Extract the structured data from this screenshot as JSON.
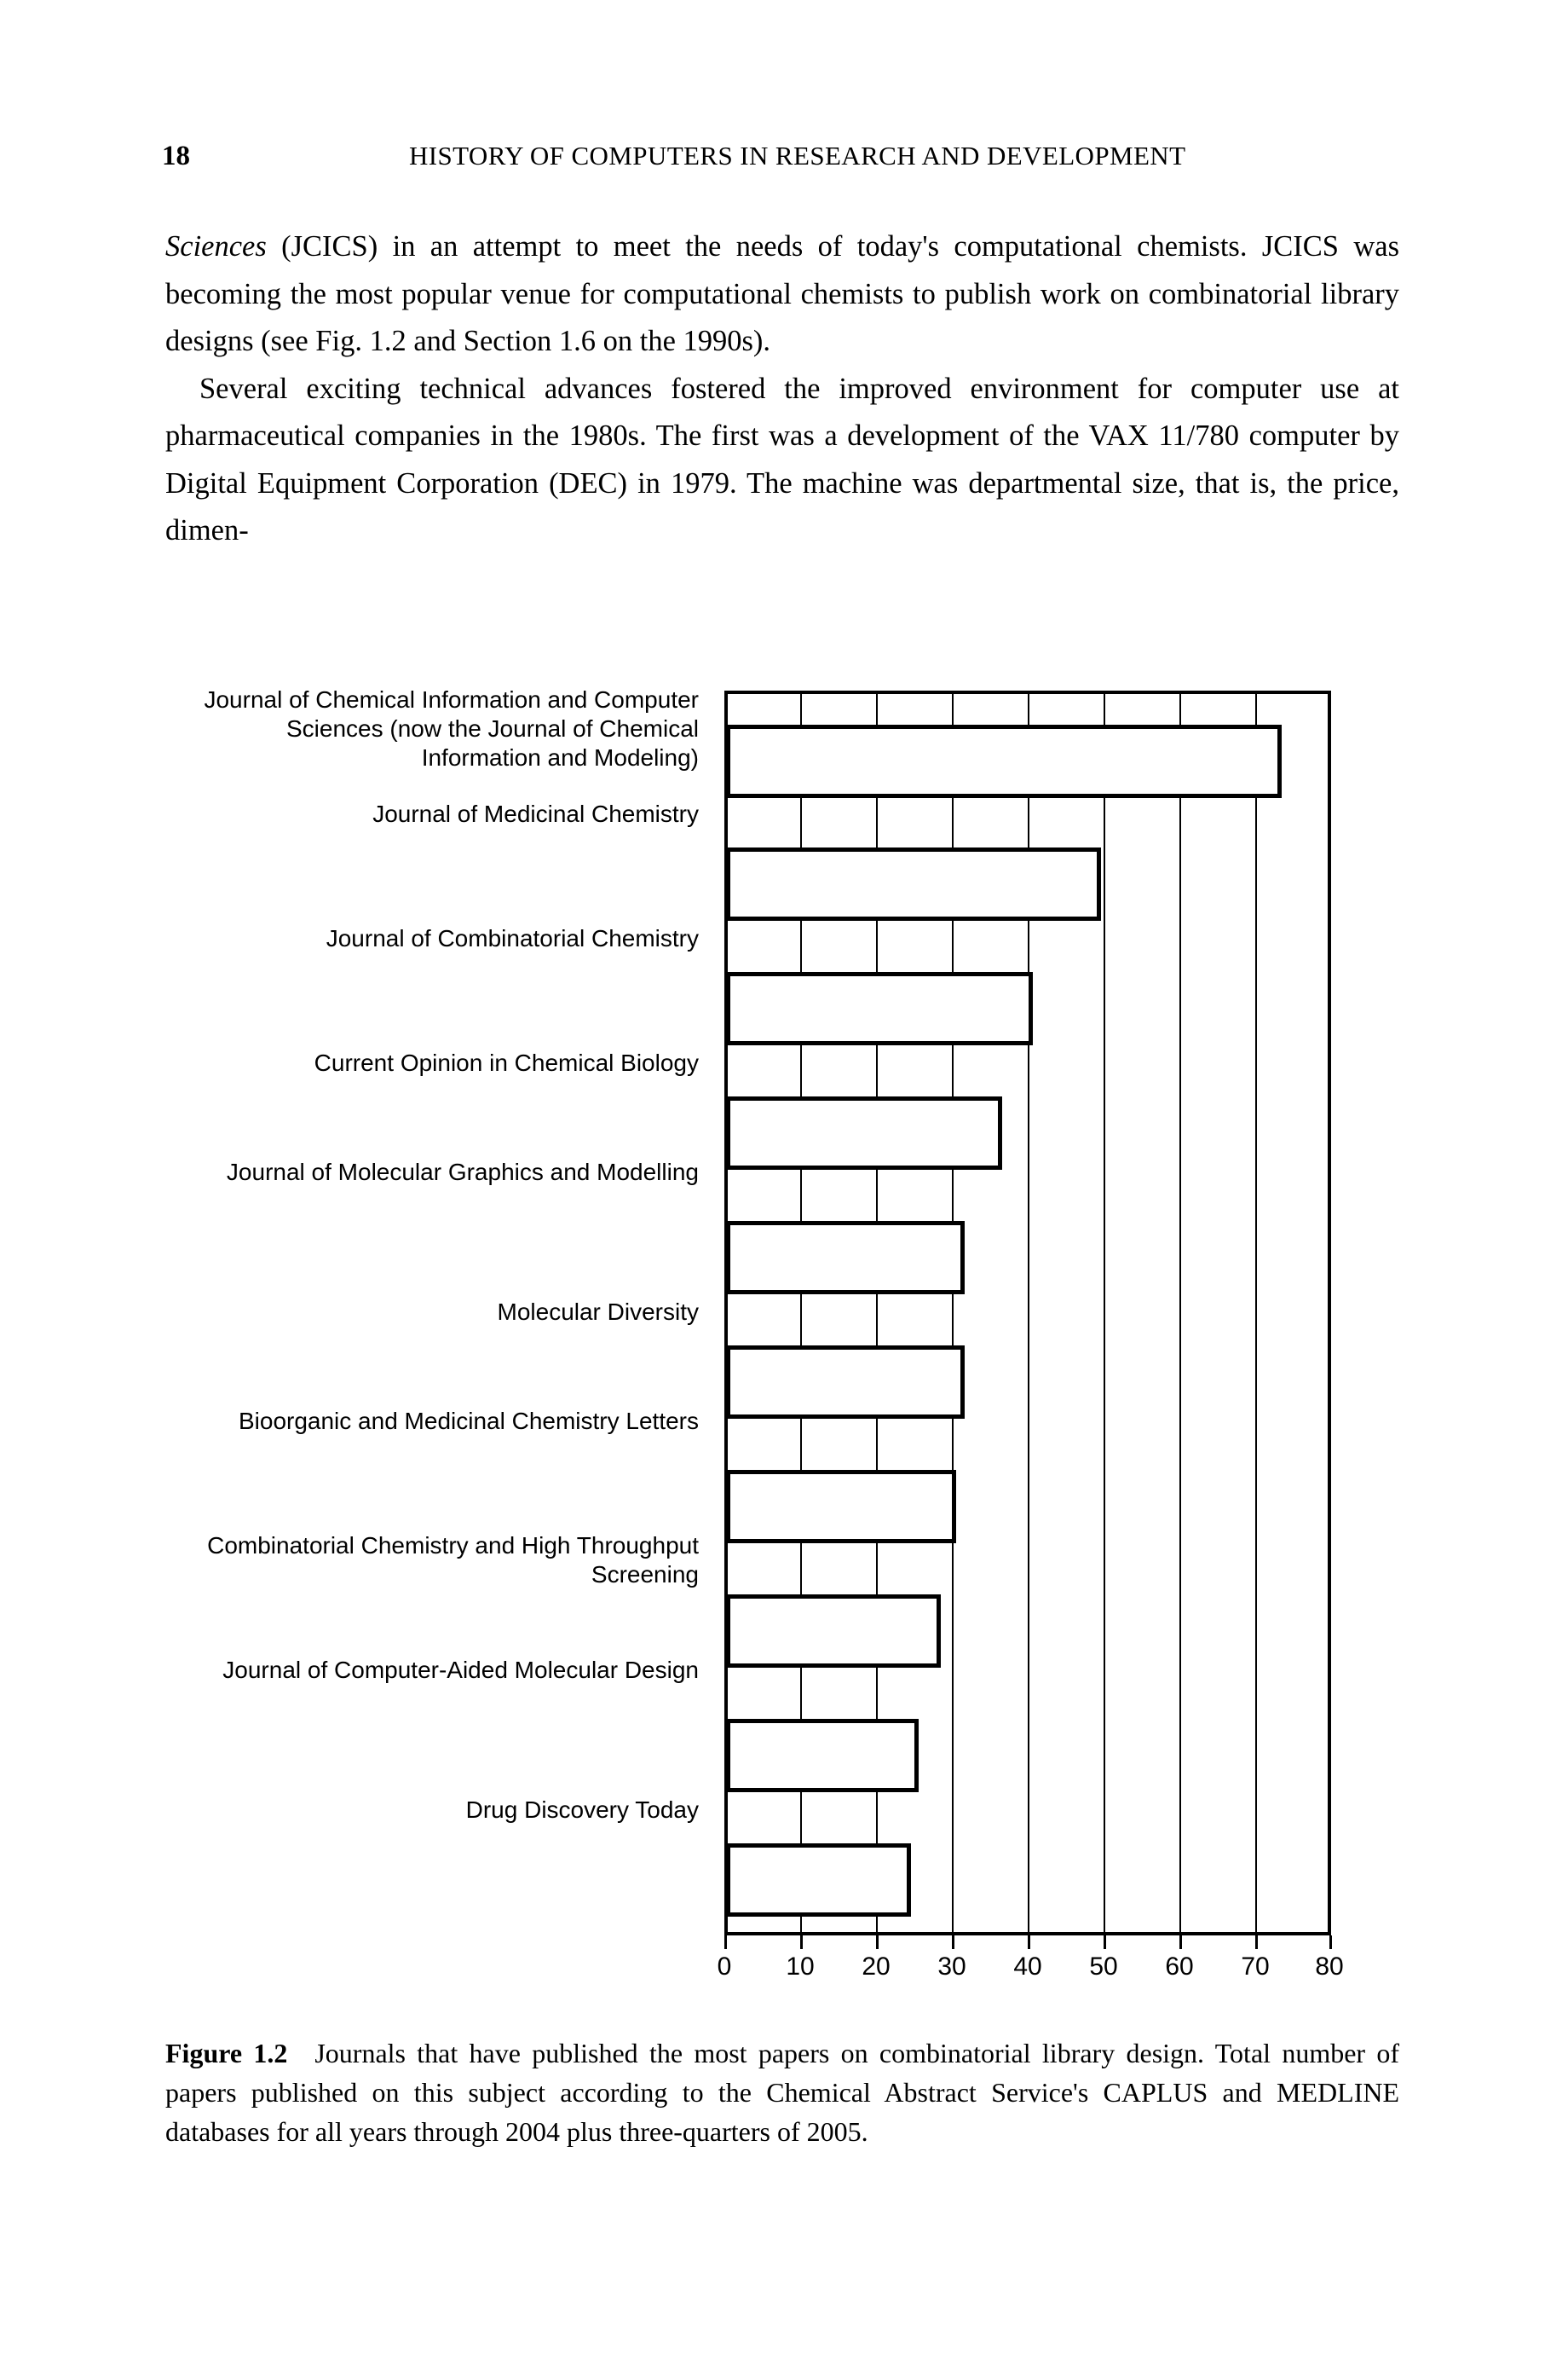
{
  "running_head": {
    "folio": "18",
    "title": "HISTORY OF COMPUTERS IN RESEARCH AND DEVELOPMENT"
  },
  "body": {
    "para1_italic_lead": "Sciences",
    "para1_rest": " (JCICS) in an attempt to meet the needs of today's computational chemists. JCICS was becoming the most popular venue for computational chemists to publish work on combinatorial library designs (see Fig. 1.2 and Section 1.6 on the 1990s).",
    "para2": "Several exciting technical advances fostered the improved environment for computer use at pharmaceutical companies in the 1980s. The first was a development of the VAX 11/780 computer by Digital Equipment Corporation (DEC) in 1979. The machine was departmental size, that is, the price, dimen-"
  },
  "caption": {
    "label": "Figure 1.2",
    "text": "Journals that have published the most papers on combinatorial library design. Total number of papers published on this subject according to the Chemical Abstract Service's CAPLUS and MEDLINE databases for all years through 2004 plus three-quarters of 2005."
  },
  "chart_data": {
    "type": "bar",
    "orientation": "horizontal",
    "title": "",
    "xlabel": "",
    "ylabel": "",
    "xlim": [
      0,
      80
    ],
    "xticks": [
      "0",
      "10",
      "20",
      "30",
      "40",
      "50",
      "60",
      "70",
      "80"
    ],
    "grid": "vertical",
    "legend": "none",
    "bar_fill": "#ffffff",
    "bar_edge": "#000000",
    "categories": [
      "Journal of Chemical Information and Computer Sciences (now the Journal of Chemical Information and Modeling)",
      "Journal of Medicinal Chemistry",
      "Journal of Combinatorial Chemistry",
      "Current Opinion in Chemical Biology",
      "Journal of Molecular Graphics and Modelling",
      "Molecular Diversity",
      "Bioorganic and Medicinal Chemistry Letters",
      "Combinatorial Chemistry and High Throughput Screening",
      "Journal of Computer-Aided Molecular Design",
      "Drug Discovery Today"
    ],
    "values": [
      73,
      49,
      40,
      36,
      31,
      31,
      30,
      28,
      25,
      24
    ]
  }
}
